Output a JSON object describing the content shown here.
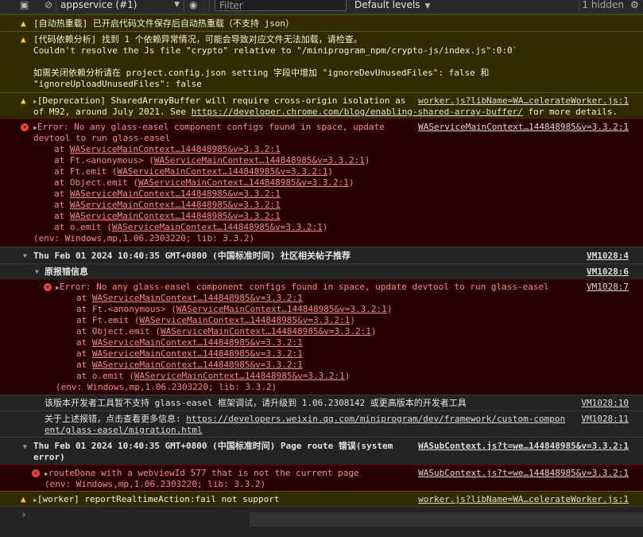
{
  "toolbar": {
    "context": "appservice (#1)",
    "filter_placeholder": "Filter",
    "levels": "Default levels",
    "hidden": "1 hidden"
  },
  "messages": {
    "m1": "[自动热重载] 已开启代码文件保存后自动热重载（不支持 json）",
    "m2_l1": "[代码依赖分析] 找到 1 个依赖异常情况，可能会导致对应文件无法加载，请检查。",
    "m2_l2": "Couldn't resolve the Js file \"crypto\" relative to \"/miniprogram_npm/crypto-js/index.js\":0:0`",
    "m2_l3": "如需关闭依赖分析请在 project.config.json setting 字段中增加 \"ignoreDevUnusedFiles\": false 和",
    "m2_l4": "\"ignoreUploadUnusedFiles\": false",
    "m3_l1": "[Deprecation] SharedArrayBuffer will require cross-origin isolation as",
    "m3_src": "worker.js?libName=WA…celerateWorker.js:1",
    "m3_l2a": "of M92, around July 2021. See ",
    "m3_link": "https://developer.chrome.com/blog/enabling-shared-array-buffer/",
    "m3_l2b": " for more details.",
    "m4_l1": "Error: No any glass-easel component configs found in space, update",
    "m4_src": "WAServiceMainContext…144848985&v=3.3.2:1",
    "m4_l2": "devtool to run glass-easel",
    "stack": [
      {
        "pre": "at ",
        "fn": "",
        "link": "WAServiceMainContext…144848985&v=3.3.2:1",
        "paren": false
      },
      {
        "pre": "at ",
        "fn": "Ft.<anonymous> ",
        "link": "WAServiceMainContext…144848985&v=3.3.2:1",
        "paren": true
      },
      {
        "pre": "at ",
        "fn": "Ft.emit ",
        "link": "WAServiceMainContext…144848985&v=3.3.2:1",
        "paren": true
      },
      {
        "pre": "at ",
        "fn": "Object.emit ",
        "link": "WAServiceMainContext…144848985&v=3.3.2:1",
        "paren": true
      },
      {
        "pre": "at ",
        "fn": "",
        "link": "WAServiceMainContext…144848985&v=3.3.2:1",
        "paren": false
      },
      {
        "pre": "at ",
        "fn": "",
        "link": "WAServiceMainContext…144848985&v=3.3.2:1",
        "paren": false
      },
      {
        "pre": "at ",
        "fn": "",
        "link": "WAServiceMainContext…144848985&v=3.3.2:1",
        "paren": false
      },
      {
        "pre": "at ",
        "fn": "o.emit ",
        "link": "WAServiceMainContext…144848985&v=3.3.2:1",
        "paren": true
      }
    ],
    "env": "(env: Windows,mp,1.06.2303220; lib: 3.3.2)",
    "g1_title": "Thu Feb 01 2024 10:40:35 GMT+0800 (中国标准时间) 社区相关帖子推荐",
    "g1_src": "VM1028:4",
    "g2_title": "原报错信息",
    "g2_src": "VM1028:6",
    "m5_l1": "Error: No any glass-easel component configs found in space, update devtool to run glass-easel",
    "m5_src": "VM1028:7",
    "m6": "该版本开发者工具暂不支持 glass-easel 框架调试，请升级到 1.06.2308142 或更高版本的开发者工具",
    "m6_src": "VM1028:10",
    "m7_l1a": "关于上述报错，点击查看更多信息: ",
    "m7_link1": "https://developers.weixin.qq.com/miniprogram/dev/framework/custom-compon",
    "m7_link2": "ent/glass-easel/migration.html",
    "m7_src": "VM1028:11",
    "g3_l1": "Thu Feb 01 2024 10:40:35 GMT+0800 (中国标准时间) Page route 错误(system",
    "g3_l2": "error)",
    "g3_src": "WASubContext.js?t=we…144848985&v=3.3.2:1",
    "m8_l1": "routeDone with a webviewId 577 that is not the current page",
    "m8_src": "WASubContext.js?t=we…144848985&v=3.3.2:1",
    "m8_l2": "(env: Windows,mp,1.06.2303220; lib: 3.3.2)",
    "m9": "[worker] reportRealtimeAction:fail not support",
    "m9_src": "worker.js?libName=WA…celerateWorker.js:1"
  },
  "tooltip": "http://127.0.0.1:13370/appservice/__WORKER__/worker.js?libName=WAAccelerateWorker.js:1"
}
